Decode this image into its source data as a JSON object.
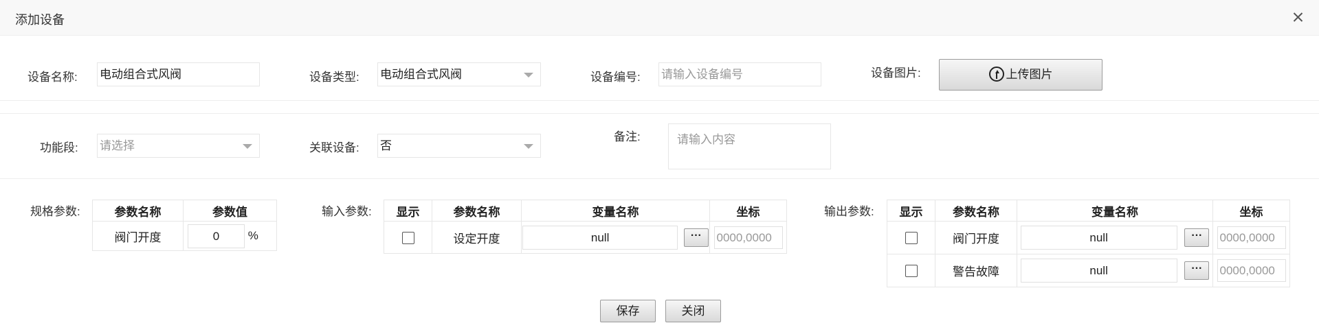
{
  "dialog": {
    "title": "添加设备",
    "close_icon": "close-icon"
  },
  "form": {
    "device_name": {
      "label": "设备名称:",
      "value": "电动组合式风阀"
    },
    "device_type": {
      "label": "设备类型:",
      "value": "电动组合式风阀"
    },
    "device_code": {
      "label": "设备编号:",
      "placeholder": "请输入设备编号"
    },
    "device_image": {
      "label": "设备图片:",
      "button": "上传图片",
      "icon": "upload-icon"
    },
    "function_section": {
      "label": "功能段:",
      "placeholder": "请选择"
    },
    "linked_device": {
      "label": "关联设备:",
      "value": "否"
    },
    "remark": {
      "label": "备注:",
      "placeholder": "请输入内容"
    }
  },
  "spec_params": {
    "label": "规格参数:",
    "headers": [
      "参数名称",
      "参数值"
    ],
    "rows": [
      {
        "name": "阀门开度",
        "value": "0",
        "unit": "%"
      }
    ]
  },
  "input_params": {
    "label": "输入参数:",
    "headers": [
      "显示",
      "参数名称",
      "变量名称",
      "坐标"
    ],
    "rows": [
      {
        "name": "设定开度",
        "variable": "null",
        "dots": "···",
        "coord_placeholder": "0000,0000"
      }
    ]
  },
  "output_params": {
    "label": "输出参数:",
    "headers": [
      "显示",
      "参数名称",
      "变量名称",
      "坐标"
    ],
    "rows": [
      {
        "name": "阀门开度",
        "variable": "null",
        "dots": "···",
        "coord_placeholder": "0000,0000"
      },
      {
        "name": "警告故障",
        "variable": "null",
        "dots": "···",
        "coord_placeholder": "0000,0000"
      }
    ]
  },
  "actions": {
    "save": "保存",
    "close": "关闭"
  }
}
